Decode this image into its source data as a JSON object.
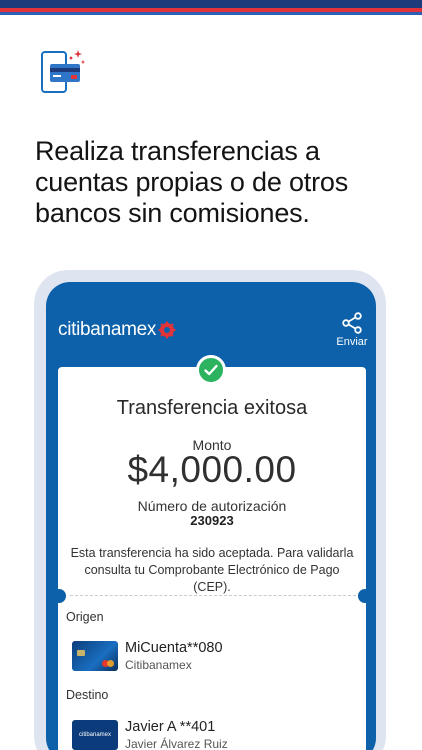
{
  "colors": {
    "brand_blue": "#0d61ab",
    "navy": "#1d3a7a",
    "red": "#e0333a",
    "success_green": "#2bb35f"
  },
  "icons": {
    "feature": "phone-card-sparkle-icon",
    "share": "share-icon",
    "check": "check-icon",
    "brand_mark": "citi-arc-logo-icon"
  },
  "headline": {
    "line1": "Realiza transferencias a",
    "line2": "cuentas propias o de otros",
    "line3": "bancos sin comisiones."
  },
  "app": {
    "brand": "citibanamex",
    "share_label": "Enviar"
  },
  "receipt": {
    "title": "Transferencia exitosa",
    "amount_label": "Monto",
    "amount": "$4,000.00",
    "auth_label": "Número de autorización",
    "auth_number": "230923",
    "note_line1": "Esta transferencia ha sido aceptada. Para validarla",
    "note_line2": "consulta tu Comprobante Electrónico de Pago (CEP)."
  },
  "origin": {
    "section_label": "Origen",
    "account_name": "MiCuenta**080",
    "bank": "Citibanamex"
  },
  "destination": {
    "section_label": "Destino",
    "card_text": "citibanamex",
    "account_name": "Javier A **401",
    "holder": "Javier Álvarez Ruiz"
  }
}
